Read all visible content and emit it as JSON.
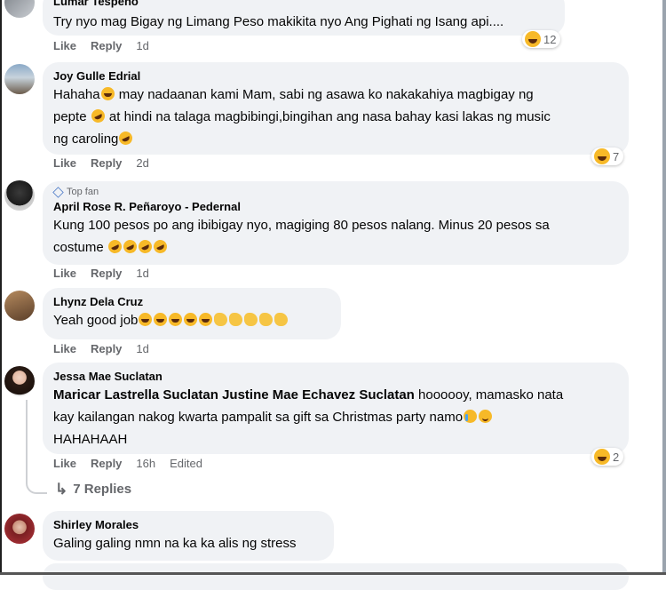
{
  "comments": [
    {
      "author": "Lumar Tespeño",
      "text": "Try nyo mag Bigay ng Limang Peso makikita nyo Ang Pighati ng Isang api....",
      "actions": {
        "like": "Like",
        "reply": "Reply",
        "time": "1d"
      },
      "reaction_count": "12"
    },
    {
      "author": "Joy Gulle Edrial",
      "text_parts": [
        "Hahaha",
        " may nadaanan kami Mam, sabi ng asawa ko nakakahiya magbigay ng",
        "pepte",
        " at hindi na talaga magbibingi,bingihan ang nasa bahay kasi lakas ng music",
        "ng caroling"
      ],
      "actions": {
        "like": "Like",
        "reply": "Reply",
        "time": "2d"
      },
      "reaction_count": "7"
    },
    {
      "badge": "Top fan",
      "author": "April Rose R. Peñaroyo - Pedernal",
      "text_parts": [
        "Kung 100 pesos po ang ibibigay nyo, magiging 80 pesos nalang. Minus 20 pesos sa",
        "costume"
      ],
      "actions": {
        "like": "Like",
        "reply": "Reply",
        "time": "1d"
      }
    },
    {
      "author": "Lhynz Dela Cruz",
      "text": "Yeah good job",
      "actions": {
        "like": "Like",
        "reply": "Reply",
        "time": "1d"
      }
    },
    {
      "author": "Jessa Mae Suclatan",
      "mention": "Maricar Lastrella Suclatan Justine Mae Echavez Suclatan",
      "text_parts": [
        " hoooooy, mamasko nata",
        "kay kailangan nakog kwarta pampalit sa gift sa Christmas party namo",
        "HAHAHAAH"
      ],
      "actions": {
        "like": "Like",
        "reply": "Reply",
        "time": "16h",
        "edited": "Edited"
      },
      "reaction_count": "2",
      "replies_label": "7 Replies"
    },
    {
      "author": "Shirley Morales",
      "text": "Galing galing nmn na ka ka alis ng stress"
    }
  ],
  "colors": {
    "bubble": "#f0f2f5",
    "secondary_text": "#65676b",
    "reaction_yellow": "#f7b928"
  }
}
